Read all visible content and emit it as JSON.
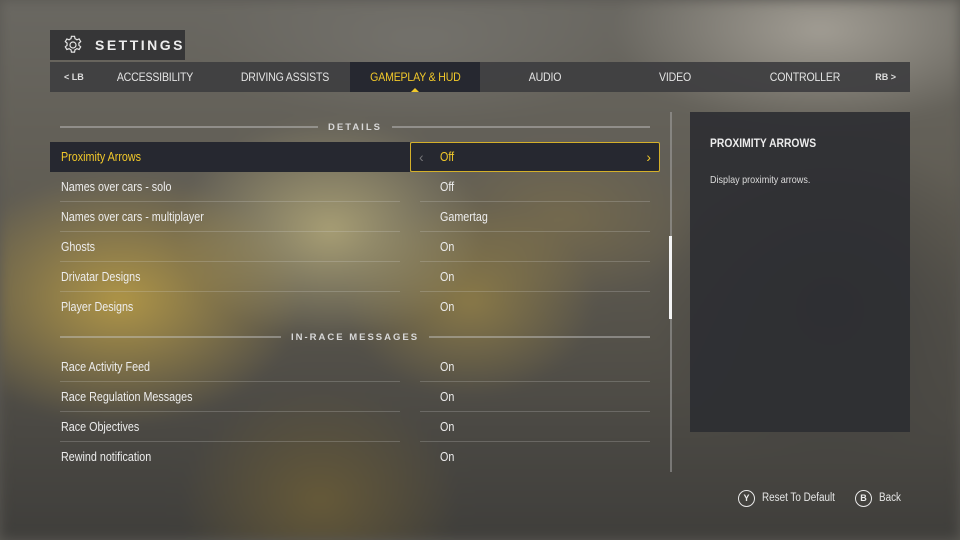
{
  "header": {
    "title": "SETTINGS",
    "icon": "gear-icon"
  },
  "tabbar": {
    "prev_bumper": "< LB",
    "next_bumper": "RB >",
    "tabs": [
      {
        "label": "ACCESSIBILITY",
        "active": false
      },
      {
        "label": "DRIVING ASSISTS",
        "active": false
      },
      {
        "label": "GAMEPLAY & HUD",
        "active": true
      },
      {
        "label": "AUDIO",
        "active": false
      },
      {
        "label": "VIDEO",
        "active": false
      },
      {
        "label": "CONTROLLER",
        "active": false
      }
    ]
  },
  "sections": [
    {
      "title": "DETAILS",
      "items": [
        {
          "name": "Proximity Arrows",
          "value": "Off",
          "selected": true
        },
        {
          "name": "Names over cars - solo",
          "value": "Off"
        },
        {
          "name": "Names over cars - multiplayer",
          "value": "Gamertag"
        },
        {
          "name": "Ghosts",
          "value": "On"
        },
        {
          "name": "Drivatar Designs",
          "value": "On"
        },
        {
          "name": "Player Designs",
          "value": "On"
        }
      ]
    },
    {
      "title": "IN-RACE MESSAGES",
      "items": [
        {
          "name": "Race Activity Feed",
          "value": "On"
        },
        {
          "name": "Race Regulation Messages",
          "value": "On"
        },
        {
          "name": "Race Objectives",
          "value": "On"
        },
        {
          "name": "Rewind notification",
          "value": "On"
        }
      ]
    }
  ],
  "selector": {
    "left_arrow": "‹",
    "right_arrow": "›"
  },
  "info_panel": {
    "title": "PROXIMITY ARROWS",
    "description": "Display proximity arrows."
  },
  "footer": {
    "hints": [
      {
        "button": "Y",
        "label": "Reset To Default"
      },
      {
        "button": "B",
        "label": "Back"
      }
    ]
  },
  "colors": {
    "accent": "#f2c92a",
    "selected_bg": "#262830",
    "panel_bg": "#2c2e32"
  }
}
